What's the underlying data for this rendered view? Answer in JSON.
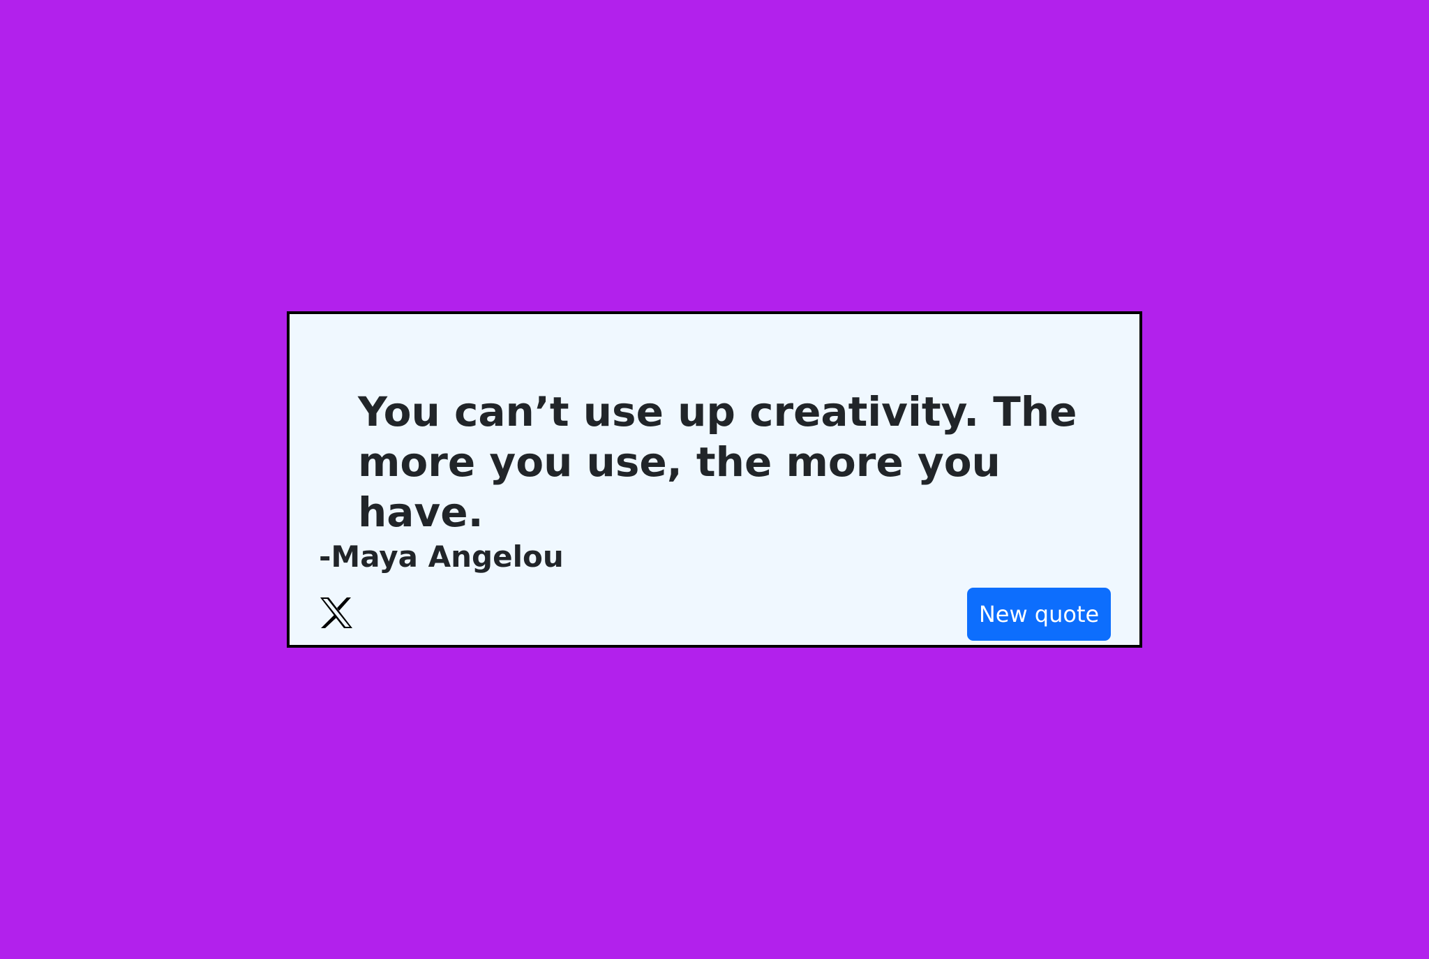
{
  "page": {
    "background_color": "#b221ec"
  },
  "quote_box": {
    "background_color": "#f0f8ff",
    "border_color": "#000000",
    "text": "You can’t use up creativity. The more you use, the more you have.",
    "author": "-Maya Angelou"
  },
  "actions": {
    "tweet_icon": "x-logo-icon",
    "new_quote_label": "New quote",
    "new_quote_color": "#0d6efd"
  }
}
